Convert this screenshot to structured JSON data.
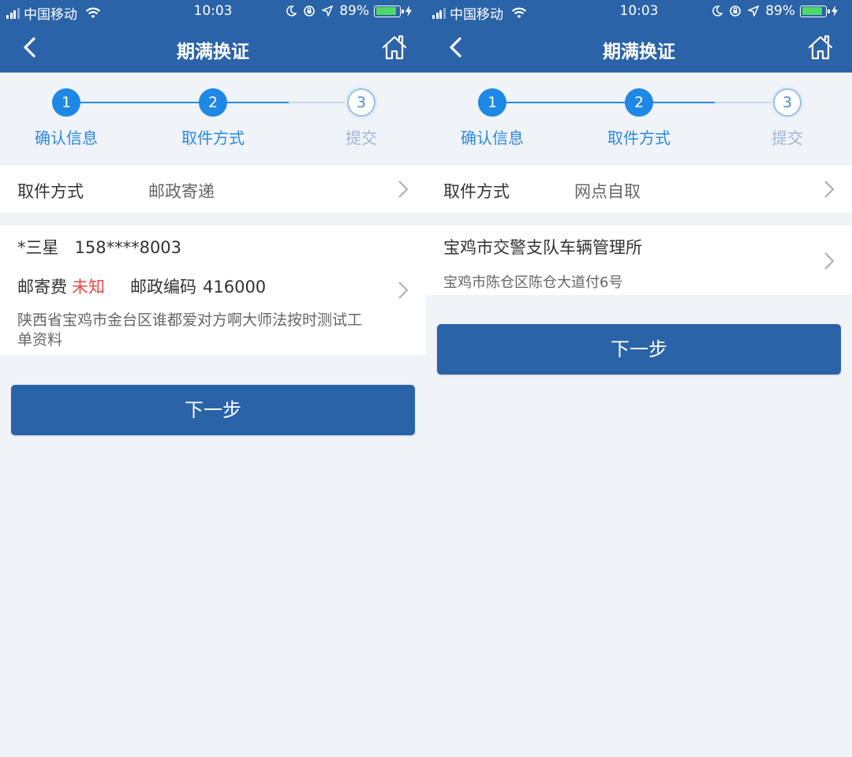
{
  "colors": {
    "primary": "#2b63a8",
    "step_active": "#1e88e5",
    "warning": "#e84a4a",
    "background": "#f0f3f7"
  },
  "screens": [
    {
      "status_bar": {
        "carrier": "中国移动",
        "time": "10:03",
        "battery": "89%"
      },
      "nav": {
        "title": "期满换证",
        "back_icon": "chevron-left-icon",
        "home_icon": "home-icon"
      },
      "steps": [
        {
          "number": "1",
          "label": "确认信息",
          "state": "done"
        },
        {
          "number": "2",
          "label": "取件方式",
          "state": "active"
        },
        {
          "number": "3",
          "label": "提交",
          "state": "pending"
        }
      ],
      "pickup_method": {
        "label": "取件方式",
        "value": "邮政寄递"
      },
      "address": {
        "name": "*三星",
        "phone": "158****8003",
        "fee_label": "邮寄费",
        "fee_value": "未知",
        "zip_label": "邮政编码",
        "zip_value": "416000",
        "detail": "陕西省宝鸡市金台区谁都爱对方啊大师法按时测试工单资料"
      },
      "next_button": "下一步"
    },
    {
      "status_bar": {
        "carrier": "中国移动",
        "time": "10:03",
        "battery": "89%"
      },
      "nav": {
        "title": "期满换证",
        "back_icon": "chevron-left-icon",
        "home_icon": "home-icon"
      },
      "steps": [
        {
          "number": "1",
          "label": "确认信息",
          "state": "done"
        },
        {
          "number": "2",
          "label": "取件方式",
          "state": "active"
        },
        {
          "number": "3",
          "label": "提交",
          "state": "pending"
        }
      ],
      "pickup_method": {
        "label": "取件方式",
        "value": "网点自取"
      },
      "station": {
        "name": "宝鸡市交警支队车辆管理所",
        "address": "宝鸡市陈仓区陈仓大道付6号"
      },
      "next_button": "下一步"
    }
  ]
}
